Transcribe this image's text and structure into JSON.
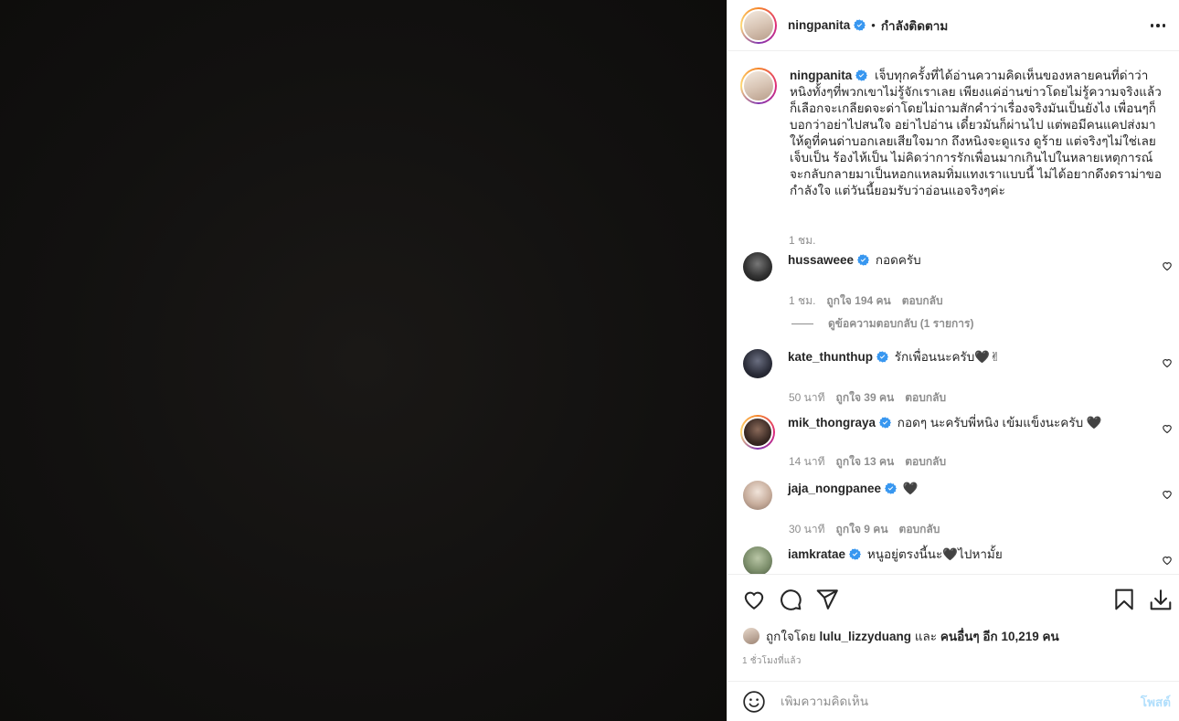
{
  "header": {
    "username": "ningpanita",
    "separator": "•",
    "follow_status": "กำลังติดตาม"
  },
  "caption": {
    "username": "ningpanita",
    "text": "เจ็บทุกครั้งที่ได้อ่านความคิดเห็นของหลายคนที่ด่าว่าหนิงทั้งๆที่พวกเขาไม่รู้จักเราเลย เพียงแค่อ่านข่าวโดยไม่รู้ความจริงแล้วก็เลือกจะเกลียดจะด่าโดยไม่ถามสักคำว่าเรื่องจริงมันเป็นยังไง เพื่อนๆก็บอกว่าอย่าไปสนใจ อย่าไปอ่าน เดี๋ยวมันก็ผ่านไป แต่พอมีคนแคปส่งมาให้ดูที่คนด่าบอกเลยเสียใจมาก ถึงหนิงจะดูแรง ดูร้าย แต่จริงๆไม่ใช่เลย เจ็บเป็น ร้องไห้เป็น ไม่คิดว่าการรักเพื่อนมากเกินไปในหลายเหตุการณ์ จะกลับกลายมาเป็นหอกแหลมทิ่มแทงเราแบบนี้ ไม่ได้อยากดึงดราม่าขอกำลังใจ แต่วันนี้ยอมรับว่าอ่อนแอจริงๆค่ะ",
    "time": "1 ชม."
  },
  "comments": [
    {
      "username": "hussaweee",
      "text": "กอดครับ",
      "time": "1 ชม.",
      "likes": "ถูกใจ 194 คน",
      "reply": "ตอบกลับ"
    },
    {
      "username": "kate_thunthup",
      "text": "รักเพื่อนนะครับ🖤✌",
      "time": "50 นาที",
      "likes": "ถูกใจ 39 คน",
      "reply": "ตอบกลับ"
    },
    {
      "username": "mik_thongraya",
      "text": "กอดๆ นะครับพี่หนิง เข้มแข็งนะครับ 🖤",
      "time": "14 นาที",
      "likes": "ถูกใจ 13 คน",
      "reply": "ตอบกลับ"
    },
    {
      "username": "jaja_nongpanee",
      "text": "🖤",
      "time": "30 นาที",
      "likes": "ถูกใจ 9 คน",
      "reply": "ตอบกลับ"
    },
    {
      "username": "iamkratae",
      "text": "หนูอยู่ตรงนี้นะ🖤ไปหามั้ย",
      "time": "",
      "likes": "",
      "reply": ""
    }
  ],
  "view_replies": "ดูข้อความตอบกลับ (1 รายการ)",
  "likes": {
    "prefix": "ถูกใจโดย",
    "user": "lulu_lizzyduang",
    "and": "และ",
    "others": "คนอื่นๆ อีก 10,219 คน"
  },
  "timestamp": "1 ชั่วโมงที่แล้ว",
  "add_comment": {
    "placeholder": "เพิ่มความคิดเห็น",
    "post_label": "โพสต์"
  },
  "colors": {
    "verified": "#3897f0",
    "post_disabled": "#b2dffc",
    "secondary_text": "#8e8e8e"
  }
}
